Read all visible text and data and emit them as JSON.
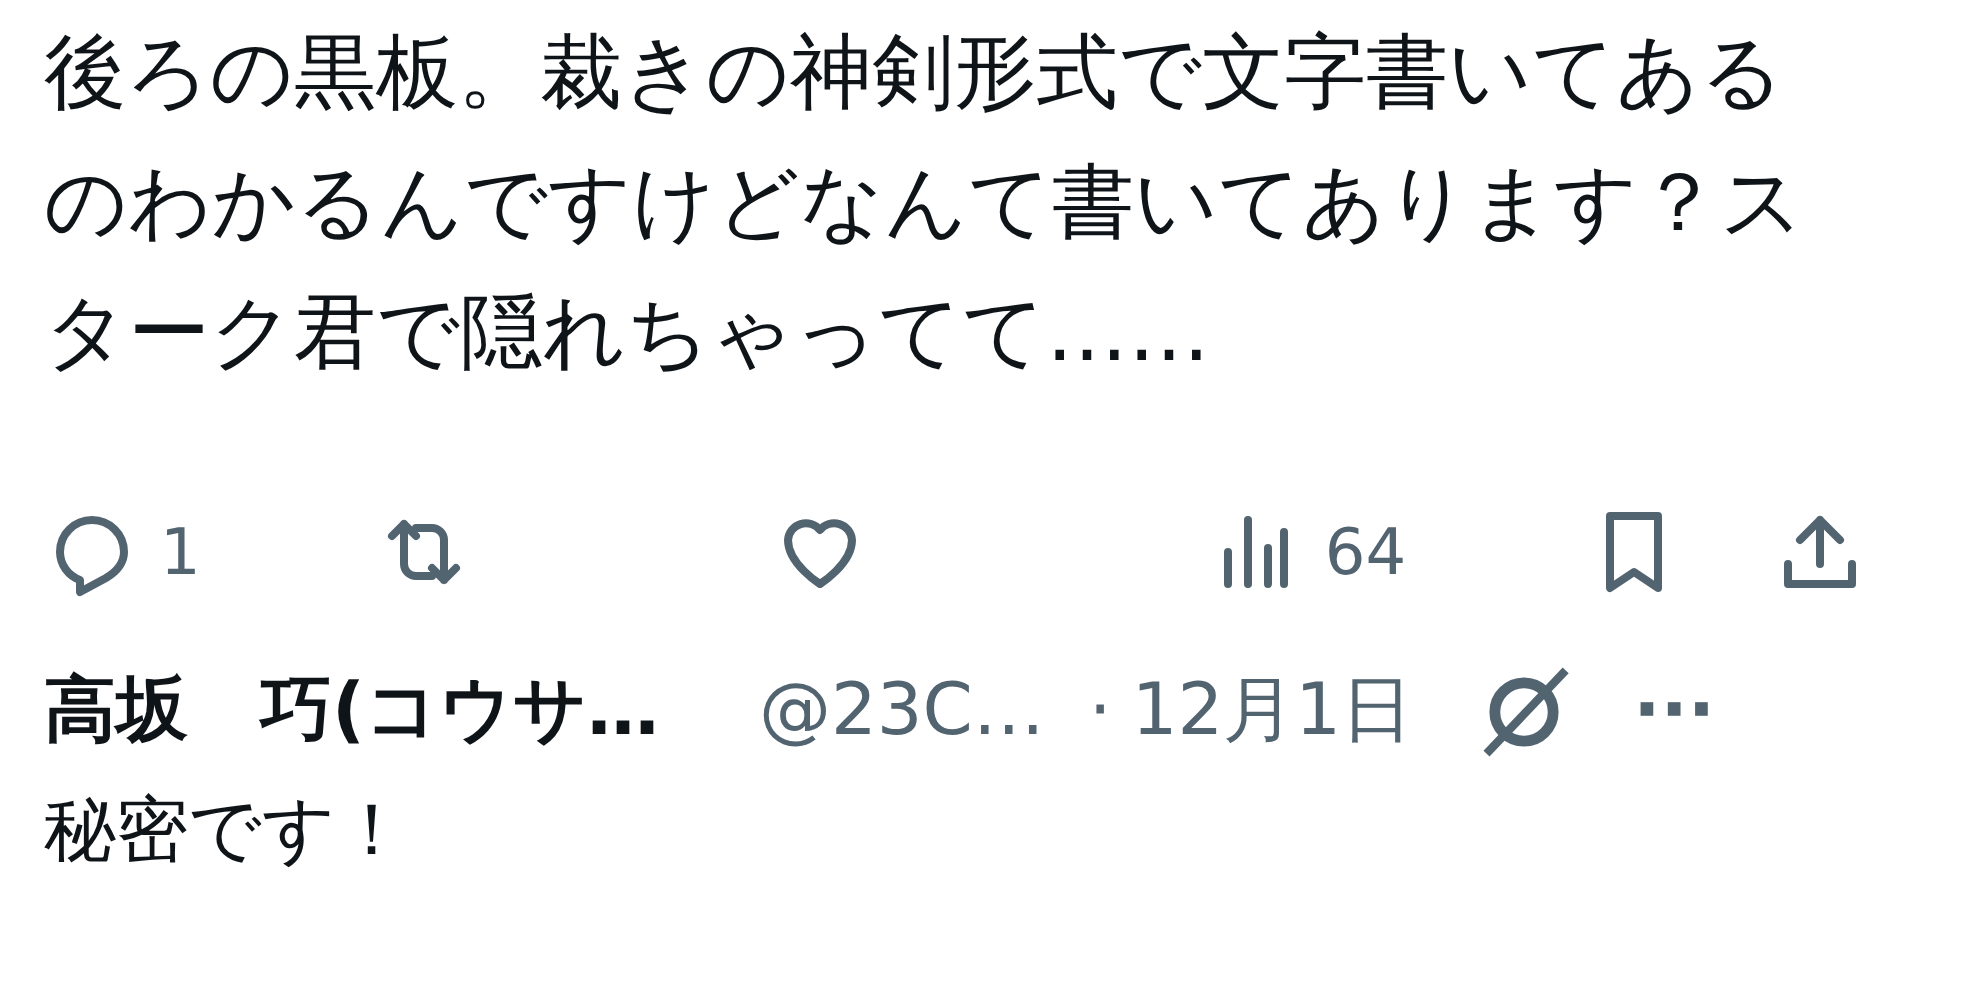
{
  "tweet": {
    "text": "後ろの黒板。裁きの神剣形式で文字書いてあるのわかるんですけどなんて書いてあります？スターク君で隠れちゃってて……",
    "actions": [
      {
        "kind": "reply",
        "count": "1"
      },
      {
        "kind": "repost"
      },
      {
        "kind": "like"
      },
      {
        "kind": "views",
        "count": "64"
      },
      {
        "kind": "bookmark"
      },
      {
        "kind": "share"
      }
    ]
  },
  "reply": {
    "name": "高坂　巧(コウサ…",
    "handle": "@23C…",
    "separator": "·",
    "date": "12月1日",
    "more": "···",
    "text": "秘密です！"
  }
}
